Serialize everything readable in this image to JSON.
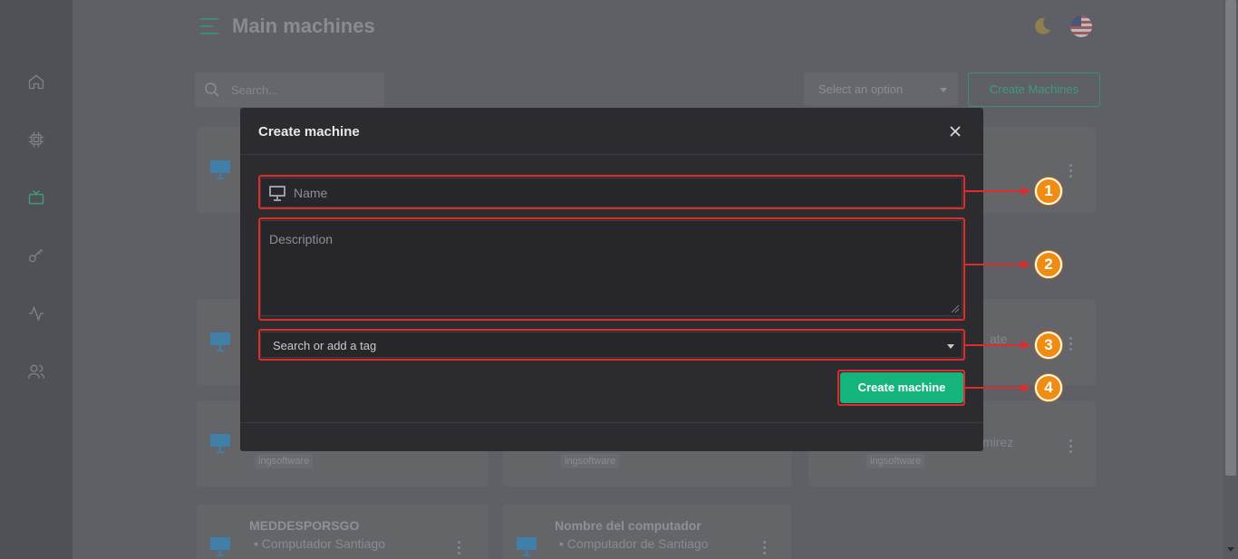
{
  "app": {
    "page_title": "Main machines",
    "search_placeholder": "Search...",
    "filter_select": "Select an option",
    "create_button": "Create Machines"
  },
  "sidebar": {
    "items": [
      {
        "icon": "home-icon"
      },
      {
        "icon": "chip-icon"
      },
      {
        "icon": "tv-icon"
      },
      {
        "icon": "key-icon"
      },
      {
        "icon": "activity-icon"
      },
      {
        "icon": "users-icon"
      }
    ]
  },
  "cards": [
    {
      "title": "",
      "subtitle": "",
      "tag": ""
    },
    {
      "title": "",
      "fragment": "ate",
      "tag": ""
    },
    {
      "title": "",
      "tag": "ingsoftware"
    },
    {
      "title": "",
      "tag": "ingsoftware"
    },
    {
      "title": "",
      "fragment": "mirez",
      "tag": "ingsoftware"
    },
    {
      "title": "MEDDESPORSGO",
      "subtitle": "• Computador Santiago"
    },
    {
      "title": "Nombre del computador",
      "subtitle": "• Computador de Santiago"
    }
  ],
  "modal": {
    "title": "Create machine",
    "name_placeholder": "Name",
    "description_placeholder": "Description",
    "tag_placeholder": "Search or add a tag",
    "submit_label": "Create machine"
  },
  "annotations": {
    "badges": [
      "1",
      "2",
      "3",
      "4"
    ],
    "color": "#e02b2b",
    "badge_color": "#f08c12"
  },
  "colors": {
    "accent": "#14b47c",
    "modal_bg": "#2b2b30"
  }
}
